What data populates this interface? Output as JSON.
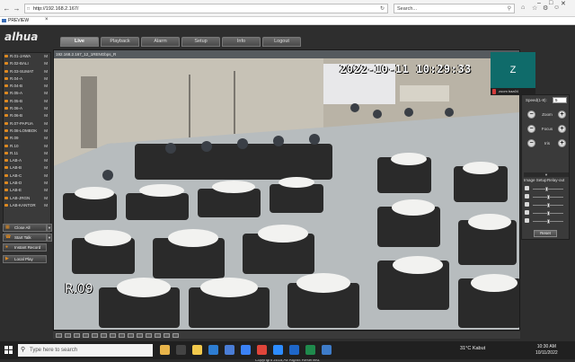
{
  "browser": {
    "url": "http://192.168.2.167/",
    "search_placeholder": "Search...",
    "tab_title": "PREVIEW"
  },
  "app": {
    "logo": "alhua",
    "menu": [
      "Live",
      "Playback",
      "Alarm",
      "Setup",
      "Info",
      "Logout"
    ],
    "active_menu": "Live"
  },
  "channels": [
    "R.01-JAWA",
    "R.02-BALI",
    "R.03-SUMAT",
    "R.04-A",
    "R.04-B",
    "R.05-A",
    "R.05-B",
    "R.06-A",
    "R.06-B",
    "R.07-PAPUA",
    "R.08-LOMBOK",
    "R.09",
    "R.10",
    "R.11",
    "LAB-A",
    "LAB-B",
    "LAB-C",
    "LAB-D",
    "LAB-E",
    "LAB-JRGN",
    "LAB-KANTOR"
  ],
  "channel_flag": "M",
  "side_buttons": {
    "close_all": "Close All",
    "start_talk": "Start Talk",
    "instant_record": "Instant Record",
    "local_play": "Local Play"
  },
  "video": {
    "header": "192.168.2.167_12_1RENGbps_R",
    "timestamp": "2022-10-11 10:29:33",
    "osd_name": "R.09"
  },
  "zoom": {
    "initial": "Z",
    "label": "zoom baa04"
  },
  "ptz": {
    "speed_label": "Speed(1-8):",
    "speed_value": "5",
    "zoom": "Zoom",
    "focus": "Focus",
    "iris": "Iris",
    "image_setup": "Image Setup",
    "relay_out": "Relay-out",
    "reset": "Reset",
    "slider_levels": [
      0.45,
      0.5,
      0.5,
      0.5,
      0.5
    ]
  },
  "footer": {
    "copyright": "Copyright 2015,All Rights Reserved."
  },
  "taskbar": {
    "search": "Type here to search",
    "weather": "31°C  Kabut",
    "time": "10:30 AM",
    "date": "10/11/2022"
  }
}
